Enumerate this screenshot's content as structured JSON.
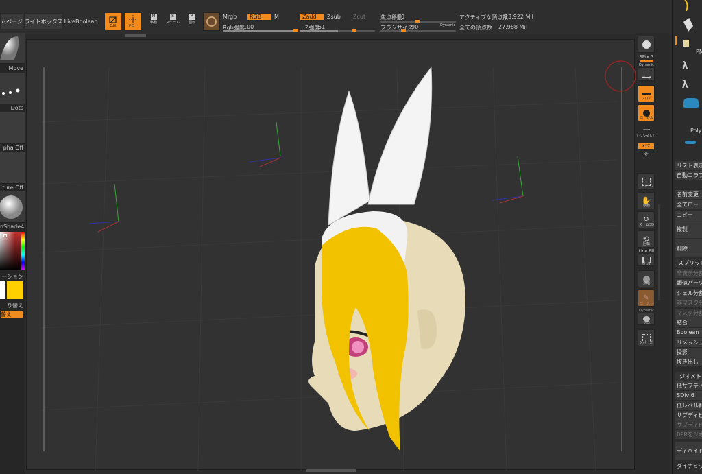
{
  "topbar": {
    "homepage": "ムページ",
    "lightbox": "ライトボックス",
    "liveboolean": "LiveBoolean",
    "edit": "Edit",
    "draw": "ドロー",
    "move": "移動",
    "scale": "スケール",
    "rotate": "回転",
    "mrgb": "Mrgb",
    "rgb": "RGB",
    "m": "M",
    "rgb_intensity_label": "Rgb強度",
    "rgb_intensity_value": "100",
    "zadd": "Zadd",
    "zsub": "Zsub",
    "zcut": "Zcut",
    "z_intensity_label": "Z強度",
    "z_intensity_value": "51",
    "focal_label": "焦点移動",
    "focal_value": "0",
    "brush_size_label": "ブラシサイズ",
    "brush_size_value": "90",
    "dynamic": "Dynamic",
    "active_points_label": "アクティブな頂点数:",
    "active_points_value": "23.922 Mil",
    "total_points_label": "全ての頂点数:",
    "total_points_value": "27.988 Mil"
  },
  "leftshelf": {
    "move": "Move",
    "dots": "Dots",
    "alpha": "pha Off",
    "texture": "ture Off",
    "material": "nShade4",
    "gradient": "ーション",
    "switch": "り替え",
    "switch2": "替え"
  },
  "rightshelf": {
    "bpr": "BPR",
    "spix_label": "SPix",
    "spix_value": "3",
    "dynamic": "Dynamic",
    "perspective": "パース",
    "floor": "フロア",
    "local": "ローカル",
    "l_sym": "Lシンメトリ",
    "xyz": "XYZ",
    "frame": "フレーム",
    "move": "移動",
    "zoom3d": "ズーム3D",
    "rotate": "回転",
    "linefill": "Line Fill",
    "polyf": "ポリF",
    "transp": "透明",
    "ghost": "ゴースト",
    "dynamic2": "Dynamic",
    "solo": "ソロ",
    "xpose": "Xポーズ"
  },
  "rightpanel": {
    "pm": "PM",
    "polym": "PolyM",
    "list_display": "リスト表示",
    "auto_collapse": "自動コラプス",
    "rename": "名前変更",
    "all_low": "全てロー",
    "copy": "コピー",
    "duplicate": "複製",
    "delete": "削除",
    "split": "スプリット",
    "split_hidden": "非表示分割",
    "split_similar": "類似パーツ分",
    "split_shell": "シェル分割",
    "split_unmasked": "非マスク分割",
    "split_masked": "マスク分割",
    "merge": "結合",
    "boolean": "Boolean",
    "remesh": "リメッシュ",
    "project": "投影",
    "extract": "抜き出し",
    "geometry": "ジオメトリ",
    "lower_subdiv": "低サブディビ",
    "sdiv_label": "SDiv",
    "sdiv_value": "6",
    "del_lower": "低レベル削除",
    "subdiv1": "サブディビジ",
    "subdiv2": "サブディビジ",
    "bpr_geo": "BPRをジオメ",
    "divide": "ディバイド",
    "dynamic_sub": "ダイナミッ"
  },
  "colors": {
    "accent": "#f28a1c",
    "primary_color": "#ffffff",
    "secondary_color": "#ffd000",
    "hair": "#f2c200",
    "skin": "#e8dcb8",
    "band": "#f2f2f2"
  }
}
